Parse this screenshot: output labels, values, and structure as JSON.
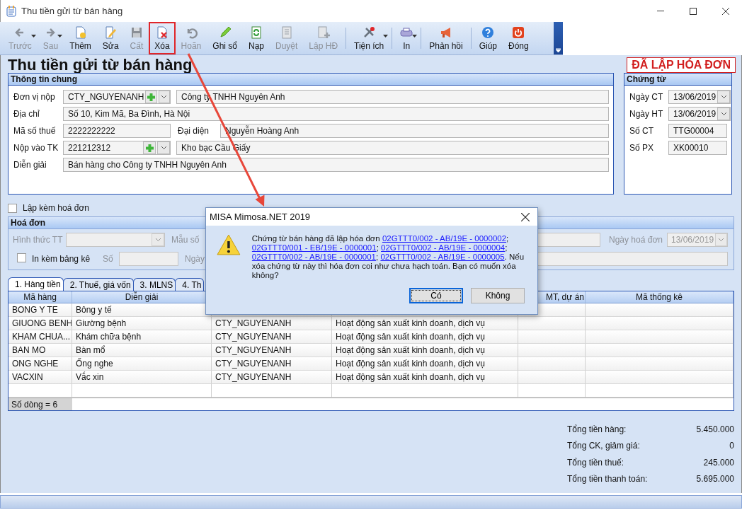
{
  "window": {
    "title": "Thu tiền gửi từ bán hàng"
  },
  "toolbar": [
    {
      "label": "Trước",
      "disabled": true,
      "dropdown": true,
      "highlighted": false
    },
    {
      "label": "Sau",
      "disabled": true,
      "dropdown": true,
      "highlighted": false
    },
    {
      "label": "Thêm",
      "disabled": false,
      "dropdown": false,
      "highlighted": false
    },
    {
      "label": "Sửa",
      "disabled": false,
      "dropdown": false,
      "highlighted": false
    },
    {
      "label": "Cất",
      "disabled": true,
      "dropdown": false,
      "highlighted": false
    },
    {
      "label": "Xóa",
      "disabled": false,
      "dropdown": false,
      "highlighted": true
    },
    {
      "label": "Hoãn",
      "disabled": true,
      "dropdown": false,
      "highlighted": false
    },
    {
      "label": "Ghi sổ",
      "disabled": false,
      "dropdown": false,
      "highlighted": false
    },
    {
      "label": "Nạp",
      "disabled": false,
      "dropdown": false,
      "highlighted": false
    },
    {
      "label": "Duyệt",
      "disabled": true,
      "dropdown": false,
      "highlighted": false
    },
    {
      "label": "Lập HĐ",
      "disabled": true,
      "dropdown": false,
      "highlighted": false
    },
    {
      "label": "Tiện ích",
      "disabled": false,
      "dropdown": true,
      "highlighted": false
    },
    {
      "label": "In",
      "disabled": false,
      "dropdown": true,
      "highlighted": false
    },
    {
      "label": "Phản hồi",
      "disabled": false,
      "dropdown": false,
      "highlighted": false
    },
    {
      "label": "Giúp",
      "disabled": false,
      "dropdown": false,
      "highlighted": false
    },
    {
      "label": "Đóng",
      "disabled": false,
      "dropdown": false,
      "highlighted": false
    }
  ],
  "heading": "Thu tiền gửi từ bán hàng",
  "status_badge": "ĐÃ LẬP HÓA ĐƠN",
  "general": {
    "title": "Thông tin chung",
    "rows": [
      {
        "kind": "lookup",
        "label": "Đơn vị nộp",
        "code": "CTY_NGUYENANH",
        "name": "Công ty TNHH Nguyên Anh"
      },
      {
        "kind": "text",
        "label": "Địa chỉ",
        "value": "Số 10, Kim Mã, Ba Đình, Hà Nội"
      },
      {
        "kind": "pair",
        "label": "Mã số thuế",
        "value": "2222222222",
        "label2": "Đại diện",
        "value2": "Nguyễn Hoàng Anh"
      },
      {
        "kind": "lookup",
        "label": "Nộp vào TK",
        "code": "221212312",
        "name": "Kho bạc Cầu Giấy"
      },
      {
        "kind": "text",
        "label": "Diễn giải",
        "value": "Bán hàng cho Công ty TNHH Nguyên Anh"
      }
    ]
  },
  "voucher": {
    "title": "Chứng từ",
    "rows": [
      {
        "kind": "date",
        "label": "Ngày CT",
        "value": "13/06/2019"
      },
      {
        "kind": "date",
        "label": "Ngày HT",
        "value": "13/06/2019"
      },
      {
        "kind": "text",
        "label": "Số CT",
        "value": "TTG00004"
      },
      {
        "kind": "text",
        "label": "Số PX",
        "value": "XK00010"
      }
    ]
  },
  "attach_invoice": {
    "label": "Lập kèm hoá đơn",
    "checked": false
  },
  "invoice": {
    "title": "Hoá đơn",
    "disabled": true,
    "payment_label": "Hình thức TT",
    "template_label": "Mẫu số",
    "date_label": "Ngày hoá đơn",
    "date_value": "13/06/2019",
    "print_list": {
      "label": "In kèm bảng kê",
      "checked": false
    },
    "number_label": "Số",
    "day_label": "Ngày"
  },
  "tabs": [
    {
      "label": "1. Hàng tiền",
      "selected": true
    },
    {
      "label": "2. Thuế, giá vốn",
      "selected": false
    },
    {
      "label": "3. MLNS",
      "selected": false
    },
    {
      "label": "4. Th",
      "selected": false
    }
  ],
  "table": {
    "columns": [
      {
        "label": "Mã hàng"
      },
      {
        "label": "Diễn giải"
      },
      {},
      {},
      {
        "label": "MT, dự án"
      },
      {
        "label": "Mã thống kê"
      }
    ],
    "rows": [
      {
        "code": "BONG Y TE",
        "description": "Bông y tế"
      },
      {
        "code": "GIUONG BENH",
        "description": "Giường bệnh",
        "column_3": "CTY_NGUYENANH",
        "column_4": "Hoạt động sản xuất kinh doanh, dịch vụ"
      },
      {
        "code": "KHAM CHUA...",
        "description": "Khám chữa bệnh",
        "column_3": "CTY_NGUYENANH",
        "column_4": "Hoạt động sản xuất kinh doanh, dịch vụ"
      },
      {
        "code": "BAN MO",
        "description": "Bàn mổ",
        "column_3": "CTY_NGUYENANH",
        "column_4": "Hoạt động sản xuất kinh doanh, dịch vụ"
      },
      {
        "code": "ONG NGHE",
        "description": "Ống nghe",
        "column_3": "CTY_NGUYENANH",
        "column_4": "Hoạt động sản xuất kinh doanh, dịch vụ"
      },
      {
        "code": "VACXIN",
        "description": "Vắc xin",
        "column_3": "CTY_NGUYENANH",
        "column_4": "Hoạt động sản xuất kinh doanh, dịch vụ"
      }
    ],
    "row_count": "Số dòng = 6"
  },
  "totals": [
    {
      "label": "Tổng tiền hàng:",
      "value": "5.450.000"
    },
    {
      "label": "Tổng CK, giảm giá:",
      "value": "0"
    },
    {
      "label": "Tổng tiền thuế:",
      "value": "245.000"
    },
    {
      "label": "Tổng tiền thanh toán:",
      "value": "5.695.000"
    }
  ],
  "dialog": {
    "title": "MISA Mimosa.NET 2019",
    "message": [
      {
        "kind": "text",
        "text": "Chứng từ bán hàng đã lập hóa đơn "
      },
      {
        "kind": "link",
        "text": "02GTTT0/002 - AB/19E - 0000002"
      },
      {
        "kind": "text",
        "text": "; "
      },
      {
        "kind": "link",
        "text": "02GTTT0/001 - EB/19E - 0000001"
      },
      {
        "kind": "text",
        "text": "; "
      },
      {
        "kind": "link",
        "text": "02GTTT0/002 - AB/19E - 0000004"
      },
      {
        "kind": "text",
        "text": "; "
      },
      {
        "kind": "link",
        "text": "02GTTT0/002 - AB/19E - 0000001"
      },
      {
        "kind": "text",
        "text": "; "
      },
      {
        "kind": "link",
        "text": "02GTTT0/002 - AB/19E - 0000005"
      },
      {
        "kind": "text",
        "text": ". Nếu xóa chứng từ này thì hóa đơn coi như chưa hạch toán. Bạn có muốn xóa không?"
      }
    ],
    "buttons": [
      {
        "label": "Có",
        "selected": true
      },
      {
        "label": "Không",
        "selected": false
      }
    ]
  }
}
